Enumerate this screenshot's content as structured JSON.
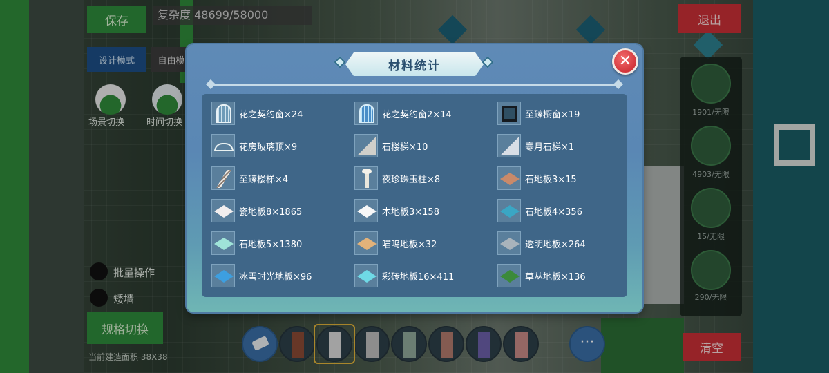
{
  "hud": {
    "save_label": "保存",
    "complexity": "复杂度 48699/58000",
    "design_mode": "设计模式",
    "free_mode": "自由模",
    "scene_switch": "场景切换",
    "time_switch": "时间切换",
    "batch_op": "批量操作",
    "short_wall": "矮墙",
    "spec_switch": "规格切换",
    "build_area": "当前建造面积 38X38",
    "exit_label": "退出",
    "clear_label": "清空",
    "right_counts": [
      "1901/无限",
      "4903/无限",
      "15/无限",
      "290/无限"
    ],
    "more_label": "···"
  },
  "dialog": {
    "title": "材料统计",
    "close_symbol": "✕",
    "items": [
      {
        "label": "花之契约窗×24",
        "icon": "window-white-icon",
        "color": "#e9f2f6"
      },
      {
        "label": "花之契约窗2×14",
        "icon": "window-blue-icon",
        "color": "#4a8ec7"
      },
      {
        "label": "至臻橱窗×19",
        "icon": "window-dark-icon",
        "color": "#151a1f"
      },
      {
        "label": "花房玻璃顶×9",
        "icon": "glass-roof-icon",
        "color": "#e9f1f1"
      },
      {
        "label": "石楼梯×10",
        "icon": "stone-stairs-icon",
        "color": "#d0cfca"
      },
      {
        "label": "寒月石梯×1",
        "icon": "moon-stairs-icon",
        "color": "#d8dee6"
      },
      {
        "label": "至臻楼梯×4",
        "icon": "premium-stairs-icon",
        "color": "#8d7d72"
      },
      {
        "label": "夜珍珠玉柱×8",
        "icon": "pearl-pillar-icon",
        "color": "#e9e7dc"
      },
      {
        "label": "石地板3×15",
        "icon": "floor-tile-icon",
        "color": "#c98a6a"
      },
      {
        "label": "瓷地板8×1865",
        "icon": "floor-tile-icon",
        "color": "#f2eeee"
      },
      {
        "label": "木地板3×158",
        "icon": "floor-tile-icon",
        "color": "#f7f7f7"
      },
      {
        "label": "石地板4×356",
        "icon": "floor-tile-icon",
        "color": "#3aa6c4"
      },
      {
        "label": "石地板5×1380",
        "icon": "floor-tile-icon",
        "color": "#9fe3d8"
      },
      {
        "label": "喵呜地板×32",
        "icon": "floor-tile-icon",
        "color": "#e2b27a"
      },
      {
        "label": "透明地板×264",
        "icon": "floor-tile-icon",
        "color": "#a9b3bb"
      },
      {
        "label": "冰雪时光地板×96",
        "icon": "floor-tile-icon",
        "color": "#3d9fe0"
      },
      {
        "label": "彩砖地板16×411",
        "icon": "floor-tile-icon",
        "color": "#6fd9e6"
      },
      {
        "label": "草丛地板×136",
        "icon": "floor-tile-icon",
        "color": "#3b8a3a"
      }
    ]
  },
  "toolbar": {
    "swatches": [
      "#8a4a35",
      "#d8d8d8",
      "#bdbdbd",
      "#8fa99a",
      "#b07a6c",
      "#6b5fa8",
      "#c78a86"
    ]
  }
}
